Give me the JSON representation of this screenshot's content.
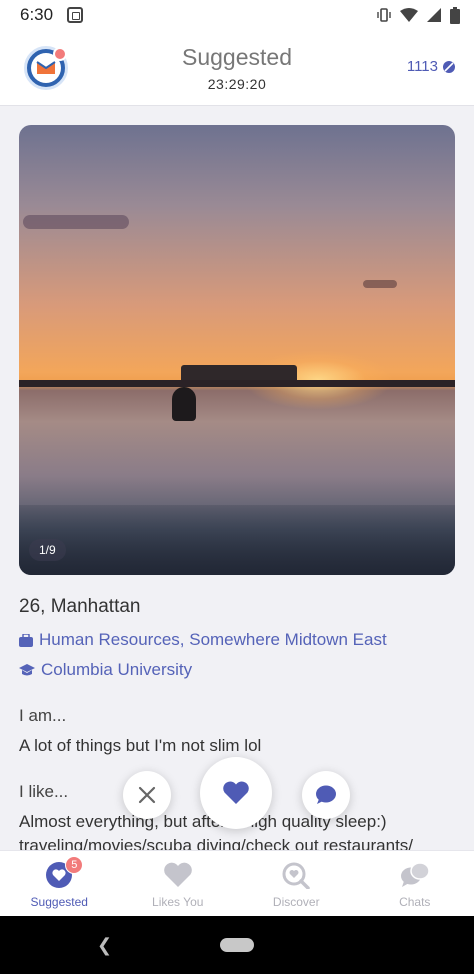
{
  "status_bar": {
    "time": "6:30"
  },
  "header": {
    "title": "Suggested",
    "timer": "23:29:20",
    "credits": "1113"
  },
  "photo": {
    "counter": "1/9"
  },
  "profile": {
    "age_location": "26, Manhattan",
    "job": "Human Resources, Somewhere Midtown East",
    "school": "Columbia University",
    "prompts": [
      {
        "label": "I am...",
        "answer": "A lot of things but I'm not slim lol"
      },
      {
        "label": "I like...",
        "answer": "Almost everything, but after a high quality sleep:)",
        "answer_cont": "traveling/movies/scuba diving/check out restaurants/"
      }
    ]
  },
  "bottom_nav": {
    "items": [
      {
        "label": "Suggested",
        "badge": "5"
      },
      {
        "label": "Likes You"
      },
      {
        "label": "Discover"
      },
      {
        "label": "Chats"
      }
    ]
  },
  "colors": {
    "accent": "#4f5bb5",
    "badge": "#f27b7b",
    "inactive": "#b0b0b8"
  },
  "icons": [
    "app-notification-icon",
    "vibrate-icon",
    "wifi-icon",
    "signal-icon",
    "battery-icon",
    "logo-icon",
    "bean-icon",
    "briefcase-icon",
    "graduation-cap-icon",
    "close-icon",
    "heart-icon",
    "chat-bubble-icon",
    "search-heart-icon",
    "chats-icon",
    "back-icon"
  ]
}
